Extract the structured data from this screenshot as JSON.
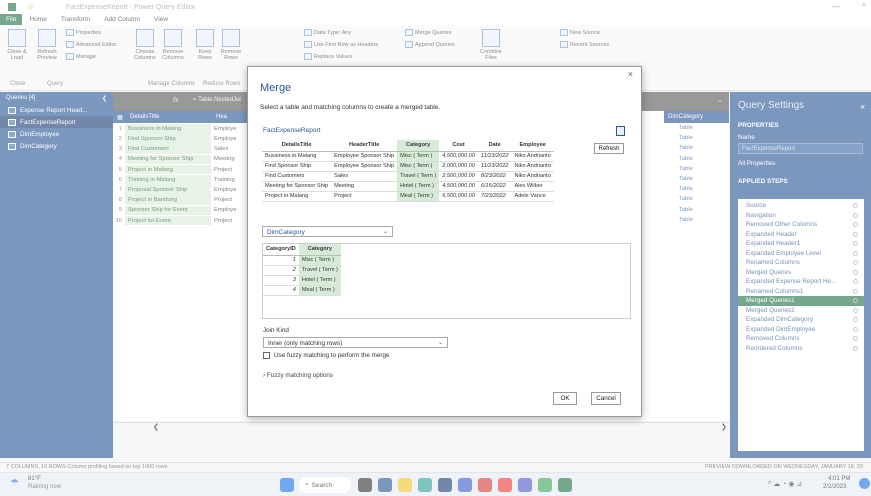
{
  "window": {
    "title": "FactExpenseReport - Power Query Editor"
  },
  "ribbon_tabs": [
    "File",
    "Home",
    "Transform",
    "Add Column",
    "View"
  ],
  "ribbon": {
    "close_load": "Close & Load",
    "refresh_preview": "Refresh Preview",
    "properties": "Properties",
    "advanced_editor": "Advanced Editor",
    "manage": "Manage",
    "choose_columns": "Choose Columns",
    "remove_columns": "Remove Columns",
    "keep_rows": "Keep Rows",
    "remove_rows": "Remove Rows",
    "data_type": "Data Type: Any",
    "first_row_headers": "Use First Row as Headers",
    "replace_values": "Replace Values",
    "merge_queries": "Merge Queries",
    "append_queries": "Append Queries",
    "combine_files": "Combine Files",
    "new_source": "New Source",
    "recent_sources": "Recent Sources",
    "group_close": "Close",
    "group_query": "Query",
    "group_manage_columns": "Manage Columns",
    "group_reduce_rows": "Reduce Rows"
  },
  "queries": {
    "header": "Queries [4]",
    "items": [
      "Expense Report Head...",
      "FactExpenseReport",
      "DimEmployee",
      "DimCategory"
    ]
  },
  "grid": {
    "formula_text": "= Table.NestedJoi",
    "col1_header": "DetailsTitle",
    "col2_header": "Hea",
    "last_header": "DimCategory",
    "rows": [
      {
        "n": "1",
        "c1": "Bussiness in Malang",
        "c2": "Employe"
      },
      {
        "n": "2",
        "c1": "Find Sponsor Ship",
        "c2": "Employe"
      },
      {
        "n": "3",
        "c1": "Find Customers",
        "c2": "Sales"
      },
      {
        "n": "4",
        "c1": "Meeting for Sponsor Ship",
        "c2": "Meeting"
      },
      {
        "n": "5",
        "c1": "Project in Malang",
        "c2": "Project"
      },
      {
        "n": "6",
        "c1": "Training in Malang",
        "c2": "Training"
      },
      {
        "n": "7",
        "c1": "Proposal Sponsor Ship",
        "c2": "Employe"
      },
      {
        "n": "8",
        "c1": "Project in Bandung",
        "c2": "Project"
      },
      {
        "n": "9",
        "c1": "Sponsor Ship for Event",
        "c2": "Employe"
      },
      {
        "n": "10",
        "c1": "Project for Event",
        "c2": "Project"
      }
    ],
    "table_cell": "Table"
  },
  "query_settings": {
    "title": "Query Settings",
    "properties": "PROPERTIES",
    "name_label": "Name",
    "name_value": "FactExpenseReport",
    "all_properties": "All Properties",
    "applied_steps": "APPLIED STEPS",
    "steps": [
      "Source",
      "Navigation",
      "Removed Other Columns",
      "Expanded Header",
      "Expanded Header1",
      "Expanded Employee Level",
      "Renamed Columns",
      "Merged Queries",
      "Expanded Expense Report He...",
      "Renamed Columns1",
      "Merged Queries1",
      "Merged Queries2",
      "Expanded DimCategory",
      "Expanded DimEmployee",
      "Removed Columns",
      "Reordered Columns"
    ],
    "selected_step": "Merged Queries1"
  },
  "status": {
    "left": "7 COLUMNS, 10 ROWS   Column profiling based on top 1000 rows",
    "right": "PREVIEW DOWNLOADED ON WEDNESDAY, JANUARY 18, 20"
  },
  "taskbar": {
    "weather_temp": "81°F",
    "weather_desc": "Raining now",
    "search": "Search",
    "time": "4:01 PM",
    "date": "2/2/2023"
  },
  "dialog": {
    "title": "Merge",
    "description": "Select a table and matching columns to create a merged table.",
    "table1_name": "FactExpenseReport",
    "refresh": "Refresh",
    "table1_headers": [
      "DetailsTitle",
      "HeaderTitle",
      "Category",
      "Cost",
      "Date",
      "Employee"
    ],
    "table1_rows": [
      [
        "Bussiness in Malang",
        "Employee Sponsor Ship",
        "Misc ( Term )",
        "4,500,000.00",
        "11/23/2022",
        "Niko Andrianto"
      ],
      [
        "Find Sponsor Ship",
        "Employee Sponsor Ship",
        "Misc ( Term )",
        "2,000,000.00",
        "11/23/2022",
        "Niko Andrianto"
      ],
      [
        "Find Customers",
        "Sales",
        "Travel ( Term )",
        "2,500,000.00",
        "8/23/2022",
        "Niko Andrianto"
      ],
      [
        "Meeting for Sponsor Ship",
        "Meeting",
        "Hotel ( Term )",
        "4,500,000.00",
        "6/15/2022",
        "Alex Wilber"
      ],
      [
        "Project in Malang",
        "Project",
        "Meal ( Term )",
        "6,500,000.00",
        "7/23/2022",
        "Adele Vance"
      ]
    ],
    "table2_select": "DimCategory",
    "table2_headers": [
      "CategoryID",
      "Category"
    ],
    "table2_rows": [
      [
        "1",
        "Misc ( Term )"
      ],
      [
        "2",
        "Travel ( Term )"
      ],
      [
        "3",
        "Hotel ( Term )"
      ],
      [
        "4",
        "Meal ( Term )"
      ]
    ],
    "join_kind_label": "Join Kind",
    "join_kind_value": "Inner (only matching rows)",
    "fuzzy_label": "Use fuzzy matching to perform the merge",
    "fuzzy_options": "Fuzzy matching options",
    "ok": "OK",
    "cancel": "Cancel"
  }
}
